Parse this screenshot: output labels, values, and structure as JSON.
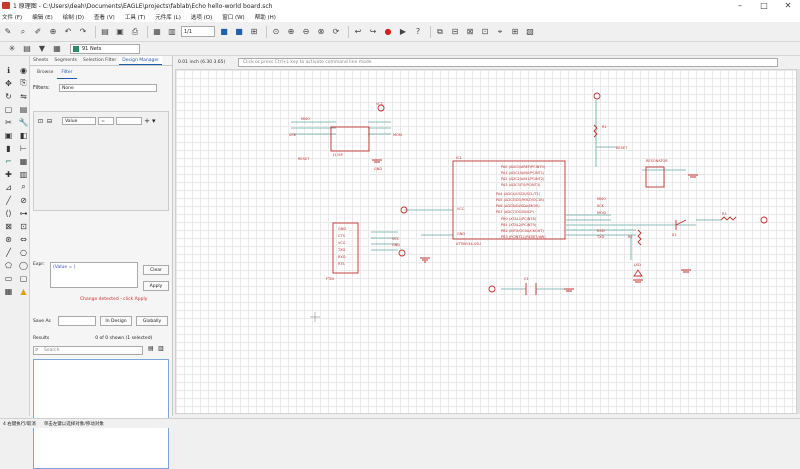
{
  "window": {
    "title": "1 原理图 - C:\\Users\\deah\\Documents\\EAGLE\\projects\\fablab\\Echo hello-world board.sch"
  },
  "menu": [
    "文件 (F)",
    "编辑 (E)",
    "绘制 (D)",
    "查看 (V)",
    "工具 (T)",
    "元件库 (L)",
    "选项 (O)",
    "窗口 (W)",
    "帮助 (H)"
  ],
  "toolbar": {
    "zoom_value": "1/1",
    "layer": "91 Nets"
  },
  "panel": {
    "tabs": [
      "Sheets",
      "Segments",
      "Selection Filter",
      "Design Manager"
    ],
    "active_tab": "Design Manager",
    "subtabs": [
      "Browse",
      "Filter"
    ],
    "active_subtab": "Filter",
    "filters_label": "Filters:",
    "filters_value": "None",
    "rule_field": "Value",
    "rule_op": "=",
    "expr_label": "Expr:",
    "expr_value": "(Value = )",
    "clear": "Clear",
    "apply": "Apply",
    "warning": "Change detected - click Apply",
    "save_as": "Save As",
    "in_design": "In Design",
    "globally": "Globally",
    "results_label": "Results",
    "results_count": "0 of 0 shown (1 selected)",
    "search_placeholder": "Search"
  },
  "cmdbar": {
    "coord": "0.01 inch (6.30 3.65)",
    "placeholder": "Click or press Ctrl+L key to activate command line mode"
  },
  "schematic": {
    "isp_labels": [
      "MISO",
      "SCK",
      "RESET",
      "VCC",
      "MOSI",
      "GND"
    ],
    "isp_name": "J1 ISP",
    "mcu_name": "IC1",
    "mcu_value": "ATTINY44-SSU",
    "mcu_pins_left": [
      "VCC",
      "GND"
    ],
    "mcu_pins_right": [
      "PA0 (ADC0/AREF/PCINT0)",
      "PA1 (ADC1/AIN0/PCINT1)",
      "PA2 (ADC2/AIN1/PCINT2)",
      "PA3 (ADC3/T0/PCINT3)",
      "PA4 (ADC4/USCK/SCL/T1)",
      "PA5 (ADC5/DO/MISO/OC1B)",
      "PA6 (ADC6/DI/SDA/MOSI)",
      "PA7 (ADC7/OC0B/ICP)",
      "PB0 (XTAL1/PCINT8)",
      "PB1 (XTAL2/PCINT9)",
      "PB2 (INT0/OC0A/CKOUT)",
      "PB3 (PCINT11/RESET/dW)"
    ],
    "net_labels": [
      "RESET",
      "MISO",
      "SCK",
      "MOSI",
      "RXD",
      "TXD",
      "VCC",
      "GND"
    ],
    "ftdi_labels": [
      "GND",
      "CTS",
      "VCC",
      "TXD",
      "RXD",
      "RTS"
    ],
    "ftdi_name": "FTDI",
    "resonator_name": "RESONATOR",
    "led_name": "LED",
    "button_name": "S1",
    "res_names": [
      "R1",
      "R2",
      "R3"
    ],
    "cap_name": "C1"
  },
  "status": {
    "left": "4 右键执行/取消",
    "right": "单击左键以选择对象/移动对象"
  }
}
